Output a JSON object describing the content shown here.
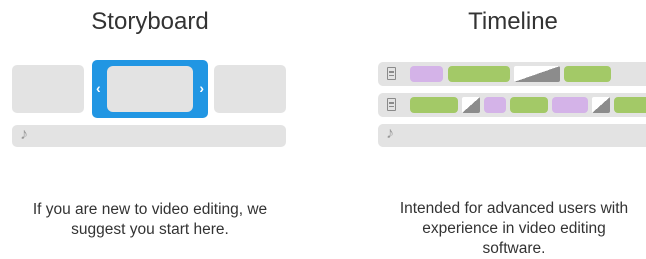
{
  "storyboard": {
    "title": "Storyboard",
    "description_line1": "If you are new to video editing, we",
    "description_line2": "suggest you start here.",
    "chevron_left": "‹",
    "chevron_right": "›",
    "note_glyph": "♪",
    "accent_color": "#2196e3"
  },
  "timeline": {
    "title": "Timeline",
    "description_line1": "Intended for advanced users with",
    "description_line2": "experience in video editing",
    "description_line3": "software.",
    "note_glyph": "♪",
    "clip_colors": {
      "purple": "#d4b3e8",
      "green": "#a3c967"
    }
  }
}
